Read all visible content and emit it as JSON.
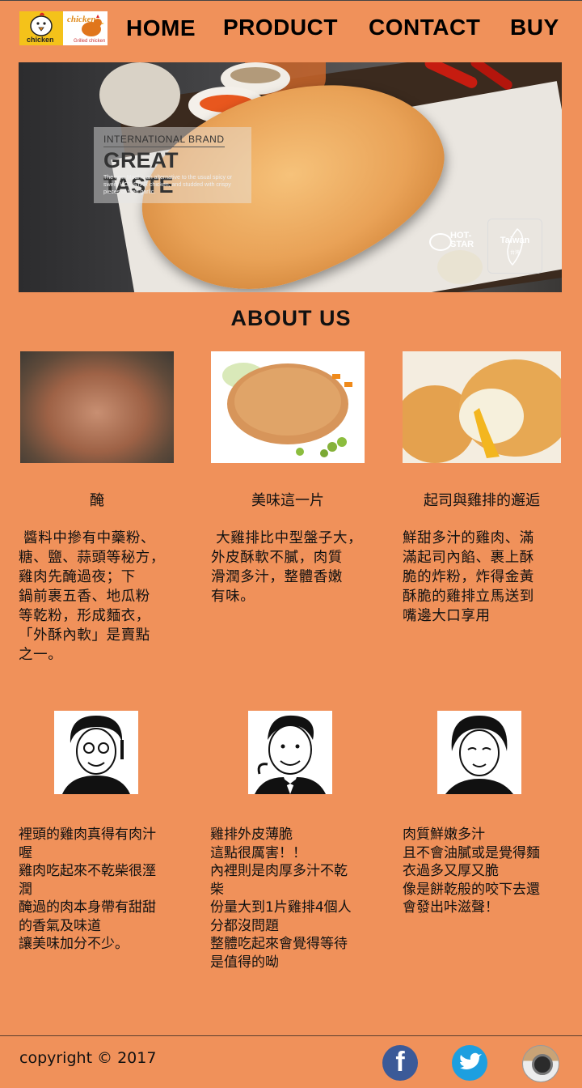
{
  "header": {
    "logo": {
      "left_caption": "chicken",
      "right_caption": "chicken",
      "right_tagline": "Grilled chicken"
    },
    "nav": [
      {
        "label": "HOME"
      },
      {
        "label": "PRODUCT"
      },
      {
        "label": "CONTACT"
      },
      {
        "label": "BUY"
      }
    ]
  },
  "banner": {
    "eyebrow": "INTERNATIONAL BRAND",
    "headline": "GREAT TASTE",
    "body": "The new Meal is an alternative to the usual spicy or sweet HOT STAR chicken, and studded with crispy pieces of fried garlic.",
    "brand_mark": "HOT-STAR",
    "origin_badge": "Taiwan",
    "origin_badge_sub": "台灣"
  },
  "about": {
    "title": "ABOUT US",
    "columns": [
      {
        "title": "醃",
        "text": " 醬料中摻有中藥粉、\n糖、鹽、蒜頭等秘方，\n雞肉先醃過夜；下\n鍋前裹五香、地瓜粉\n等乾粉，形成麵衣，\n「外酥內軟」是賣點\n之一。"
      },
      {
        "title": "美味這一片",
        "text": " 大雞排比中型盤子大，\n外皮酥軟不膩，肉質\n滑潤多汁，整體香嫩\n有味。"
      },
      {
        "title": "起司與雞排的邂逅",
        "text": "鮮甜多汁的雞肉、滿\n滿起司內餡、裹上酥\n脆的炸粉，炸得金黃\n酥脆的雞排立馬送到\n嘴邊大口享用"
      }
    ]
  },
  "reviews": [
    {
      "text": "裡頭的雞肉真得有肉汁\n喔\n雞肉吃起來不乾柴很溼\n潤\n醃過的肉本身帶有甜甜\n的香氣及味道\n讓美味加分不少。"
    },
    {
      "text": "雞排外皮薄脆\n這點很厲害！！\n內裡則是肉厚多汁不乾\n柴\n份量大到1片雞排4個人\n分都沒問題\n整體吃起來會覺得等待\n是值得的呦"
    },
    {
      "text": "肉質鮮嫩多汁\n且不會油膩或是覺得麵\n衣過多又厚又脆\n像是餅乾般的咬下去還\n會發出咔滋聲！"
    }
  ],
  "footer": {
    "copyright": "copyright © 2017",
    "social": [
      {
        "icon": "facebook-icon",
        "glyph": "f"
      },
      {
        "icon": "twitter-icon"
      },
      {
        "icon": "instagram-icon"
      }
    ]
  },
  "colors": {
    "page_bg": "#f0915a",
    "footer_rule": "#5a3d2d",
    "facebook": "#3b5a98",
    "twitter": "#1d9fe0"
  }
}
